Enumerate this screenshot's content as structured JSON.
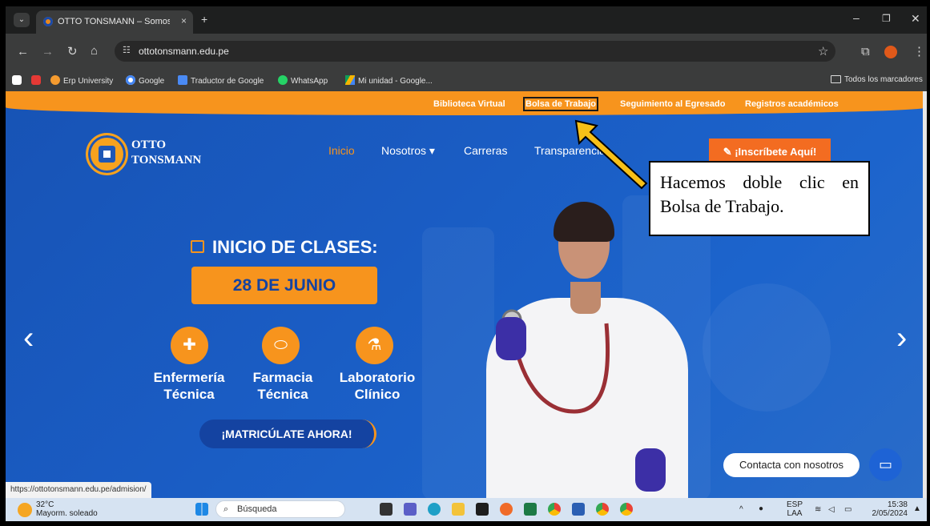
{
  "browser": {
    "tab_title": "OTTO TONSMANN – Somos Pio",
    "tab_close": "×",
    "new_tab": "+",
    "url": "ottotonsmann.edu.pe",
    "status_url": "https://ottotonsmann.edu.pe/admision/",
    "bookmarks": [
      "Erp University",
      "Google",
      "Traductor de Google",
      "WhatsApp",
      "Mi unidad - Google..."
    ],
    "all_bookmarks": "Todos los marcadores"
  },
  "site": {
    "top_links": [
      "Biblioteca Virtual",
      "Bolsa de Trabajo",
      "Seguimiento al Egresado",
      "Registros académicos"
    ],
    "logo_line1": "OTTO",
    "logo_line2": "TONSMANN",
    "nav": [
      "Inicio",
      "Nosotros ▾",
      "Carreras",
      "Transparencia"
    ],
    "cta": "¡Inscríbete Aquí!",
    "hero_title": "INICIO DE CLASES:",
    "hero_date": "28 DE JUNIO",
    "programs": [
      {
        "line1": "Enfermería",
        "line2": "Técnica",
        "icon": "nurse-cap-icon"
      },
      {
        "line1": "Farmacia",
        "line2": "Técnica",
        "icon": "pills-icon"
      },
      {
        "line1": "Laboratorio",
        "line2": "Clínico",
        "icon": "microscope-icon"
      }
    ],
    "enroll": "¡MATRICÚLATE AHORA!",
    "chat_label": "Contacta con nosotros",
    "colors": {
      "primary": "#1a5cc3",
      "accent": "#f7941d"
    }
  },
  "annotation": {
    "text": "Hacemos doble clic en Bolsa de Trabajo."
  },
  "taskbar": {
    "weather_temp": "32°C",
    "weather_desc": "Mayorm. soleado",
    "search": "Búsqueda",
    "lang1": "ESP",
    "lang2": "LAA",
    "time": "15:38",
    "date": "2/05/2024"
  }
}
